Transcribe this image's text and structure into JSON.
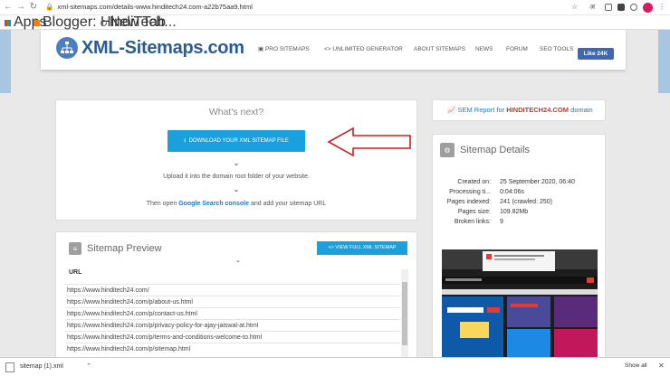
{
  "browser": {
    "url": "xml-sitemaps.com/details-www.hinditech24.com-a22b75aa9.html",
    "bookmarks": [
      "Apps",
      "Blogger: HindiTech...",
      "New Tab"
    ],
    "profile_letter": "अ"
  },
  "header": {
    "logo_text": "XML-Sitemaps.com",
    "nav": [
      "PRO SITEMAPS",
      "UNLIMITED GENERATOR",
      "ABOUT SITEMAPS",
      "NEWS",
      "FORUM",
      "SEO TOOLS"
    ],
    "fb_label": "Like 24K"
  },
  "whatsnext": {
    "title": "What's next?",
    "download_label": "DOWNLOAD YOUR XML SITEMAP FILE",
    "upload_text": "Upload it into the domain root folder of your website.",
    "then_open": "Then open",
    "console_link": "Google Search console",
    "then_open_tail": "and add your sitemap URL"
  },
  "preview": {
    "title": "Sitemap Preview",
    "view_full_label": "VIEW FULL XML SITEMAP",
    "column_header": "URL",
    "urls": [
      "https://www.hinditech24.com/",
      "https://www.hinditech24.com/p/about-us.html",
      "https://www.hinditech24.com/p/contact-us.html",
      "https://www.hinditech24.com/p/privacy-policy-for-ajay-jaiswal-at.html",
      "https://www.hinditech24.com/p/terms-and-conditions-welcome-to.html",
      "https://www.hinditech24.com/p/sitemap.html"
    ]
  },
  "sem": {
    "prefix": "SEM Report for",
    "domain": "HINDITECH24.COM",
    "suffix": "domain"
  },
  "details": {
    "title": "Sitemap Details",
    "rows": [
      {
        "label": "Created on:",
        "value": "25 September 2020, 06:40"
      },
      {
        "label": "Processing ti...",
        "value": "0:04:06s"
      },
      {
        "label": "Pages indexed:",
        "value": "241 (crawled: 250)"
      },
      {
        "label": "Pages size:",
        "value": "109.82Mb"
      },
      {
        "label": "Broken links:",
        "value": "9"
      }
    ]
  },
  "downloads": {
    "file": "sitemap (1).xml",
    "show_all": "Show all"
  },
  "colors": {
    "accent": "#1aa0dd",
    "logo": "#2a5b95",
    "arrow": "#d01f1f"
  }
}
